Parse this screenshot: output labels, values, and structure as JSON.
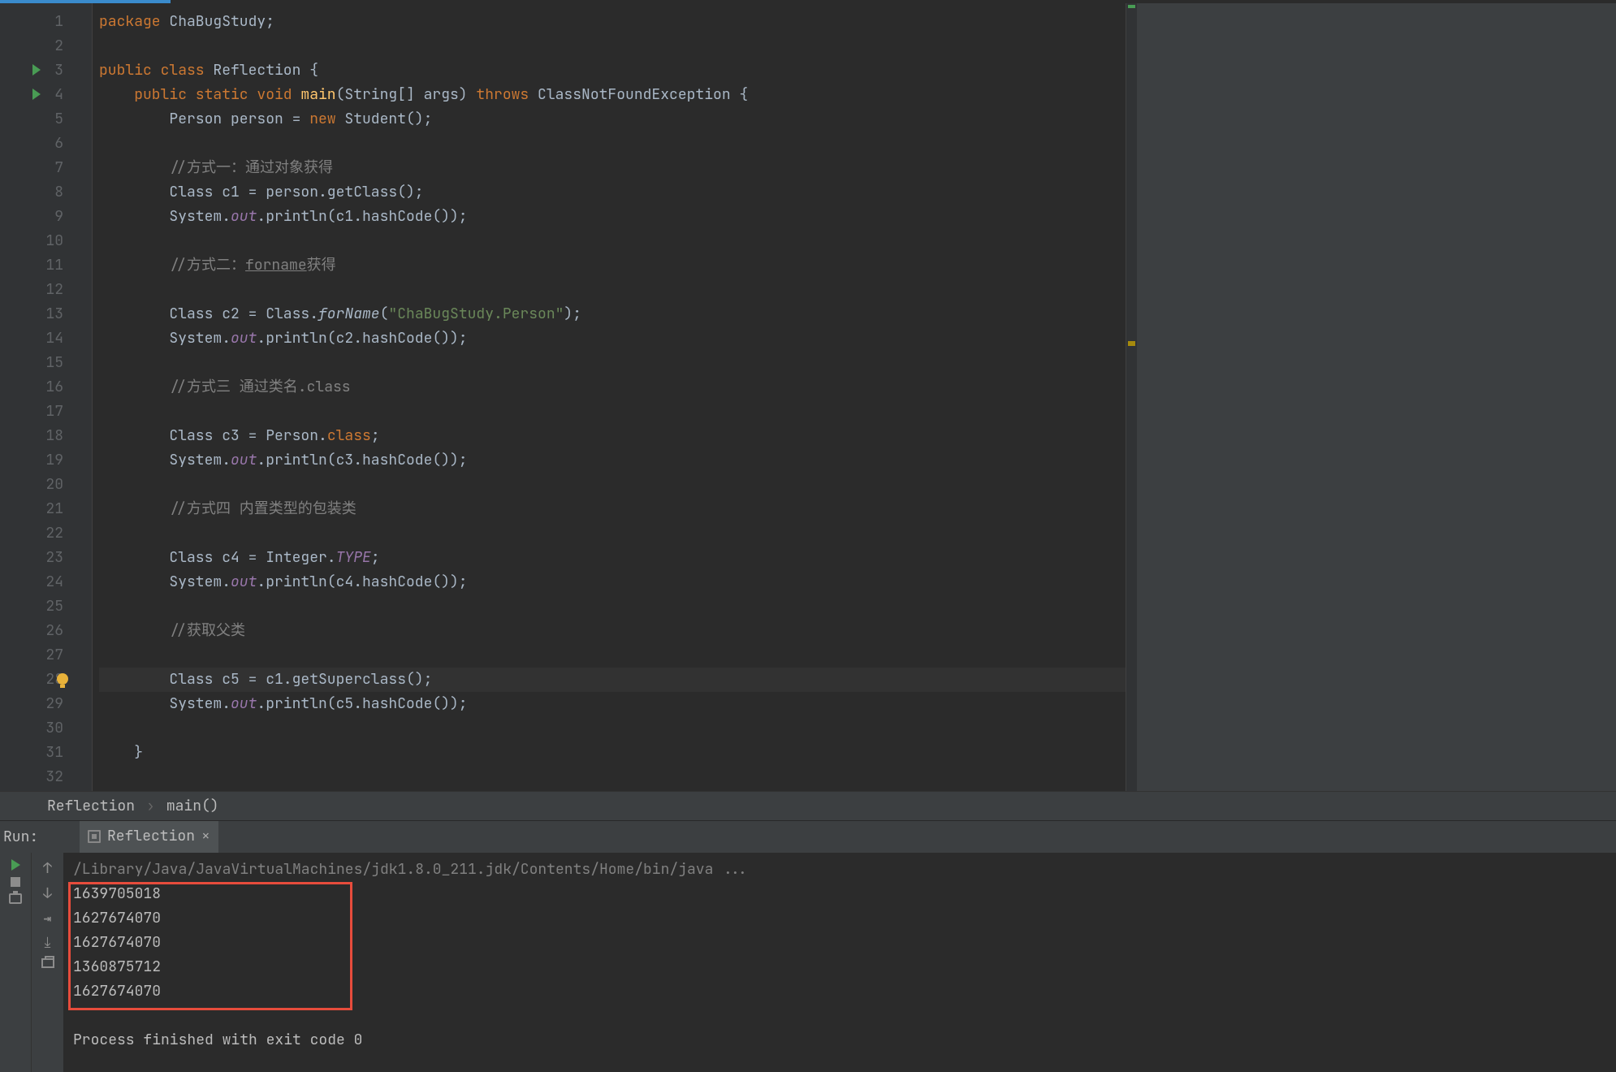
{
  "editor": {
    "lines": [
      {
        "n": 1,
        "segs": [
          {
            "c": "kw",
            "t": "package "
          },
          {
            "c": "",
            "t": "ChaBugStudy;"
          }
        ]
      },
      {
        "n": 2,
        "segs": []
      },
      {
        "n": 3,
        "icon": "run",
        "segs": [
          {
            "c": "kw",
            "t": "public class "
          },
          {
            "c": "",
            "t": "Reflection {"
          }
        ]
      },
      {
        "n": 4,
        "icon": "run",
        "segs": [
          {
            "c": "",
            "t": "    "
          },
          {
            "c": "kw",
            "t": "public static void "
          },
          {
            "c": "method",
            "t": "main"
          },
          {
            "c": "",
            "t": "(String[] args) "
          },
          {
            "c": "kw",
            "t": "throws "
          },
          {
            "c": "",
            "t": "ClassNotFoundException {"
          }
        ]
      },
      {
        "n": 5,
        "segs": [
          {
            "c": "",
            "t": "        Person person = "
          },
          {
            "c": "kw",
            "t": "new "
          },
          {
            "c": "",
            "t": "Student();"
          }
        ]
      },
      {
        "n": 6,
        "segs": []
      },
      {
        "n": 7,
        "segs": [
          {
            "c": "",
            "t": "        "
          },
          {
            "c": "comment",
            "t": "//方式一：通过对象获得"
          }
        ]
      },
      {
        "n": 8,
        "segs": [
          {
            "c": "",
            "t": "        Class c1 = person.getClass();"
          }
        ]
      },
      {
        "n": 9,
        "segs": [
          {
            "c": "",
            "t": "        System."
          },
          {
            "c": "field",
            "t": "out"
          },
          {
            "c": "",
            "t": ".println(c1.hashCode());"
          }
        ]
      },
      {
        "n": 10,
        "segs": []
      },
      {
        "n": 11,
        "segs": [
          {
            "c": "",
            "t": "        "
          },
          {
            "c": "comment",
            "t": "//方式二："
          },
          {
            "c": "comment-u",
            "t": "forname"
          },
          {
            "c": "comment",
            "t": "获得"
          }
        ]
      },
      {
        "n": 12,
        "segs": []
      },
      {
        "n": 13,
        "segs": [
          {
            "c": "",
            "t": "        Class c2 = Class."
          },
          {
            "c": "staticcall",
            "t": "forName"
          },
          {
            "c": "",
            "t": "("
          },
          {
            "c": "str",
            "t": "\"ChaBugStudy.Person\""
          },
          {
            "c": "",
            "t": ");"
          }
        ]
      },
      {
        "n": 14,
        "segs": [
          {
            "c": "",
            "t": "        System."
          },
          {
            "c": "field",
            "t": "out"
          },
          {
            "c": "",
            "t": ".println(c2.hashCode());"
          }
        ]
      },
      {
        "n": 15,
        "segs": []
      },
      {
        "n": 16,
        "segs": [
          {
            "c": "",
            "t": "        "
          },
          {
            "c": "comment",
            "t": "//方式三 通过类名.class"
          }
        ]
      },
      {
        "n": 17,
        "segs": []
      },
      {
        "n": 18,
        "segs": [
          {
            "c": "",
            "t": "        Class c3 = Person."
          },
          {
            "c": "kw",
            "t": "class"
          },
          {
            "c": "",
            "t": ";"
          }
        ]
      },
      {
        "n": 19,
        "segs": [
          {
            "c": "",
            "t": "        System."
          },
          {
            "c": "field",
            "t": "out"
          },
          {
            "c": "",
            "t": ".println(c3.hashCode());"
          }
        ]
      },
      {
        "n": 20,
        "segs": []
      },
      {
        "n": 21,
        "segs": [
          {
            "c": "",
            "t": "        "
          },
          {
            "c": "comment",
            "t": "//方式四 内置类型的包装类"
          }
        ]
      },
      {
        "n": 22,
        "segs": []
      },
      {
        "n": 23,
        "segs": [
          {
            "c": "",
            "t": "        Class c4 = Integer."
          },
          {
            "c": "field",
            "t": "TYPE"
          },
          {
            "c": "",
            "t": ";"
          }
        ]
      },
      {
        "n": 24,
        "segs": [
          {
            "c": "",
            "t": "        System."
          },
          {
            "c": "field",
            "t": "out"
          },
          {
            "c": "",
            "t": ".println(c4.hashCode());"
          }
        ]
      },
      {
        "n": 25,
        "segs": []
      },
      {
        "n": 26,
        "segs": [
          {
            "c": "",
            "t": "        "
          },
          {
            "c": "comment",
            "t": "//获取父类"
          }
        ]
      },
      {
        "n": 27,
        "segs": []
      },
      {
        "n": 28,
        "icon": "bulb",
        "cursor": true,
        "segs": [
          {
            "c": "",
            "t": "        Class c5 = c1.getSuperclass();"
          }
        ]
      },
      {
        "n": 29,
        "segs": [
          {
            "c": "",
            "t": "        System."
          },
          {
            "c": "field",
            "t": "out"
          },
          {
            "c": "",
            "t": ".println(c5.hashCode());"
          }
        ]
      },
      {
        "n": 30,
        "segs": []
      },
      {
        "n": 31,
        "segs": [
          {
            "c": "",
            "t": "    }"
          }
        ]
      },
      {
        "n": 32,
        "segs": []
      }
    ]
  },
  "breadcrumb": {
    "class": "Reflection",
    "method": "main()"
  },
  "run_panel": {
    "label": "Run:",
    "tab": "Reflection",
    "cmd": "/Library/Java/JavaVirtualMachines/jdk1.8.0_211.jdk/Contents/Home/bin/java ...",
    "out": [
      "1639705018",
      "1627674070",
      "1627674070",
      "1360875712",
      "1627674070"
    ],
    "exit": "Process finished with exit code 0"
  }
}
